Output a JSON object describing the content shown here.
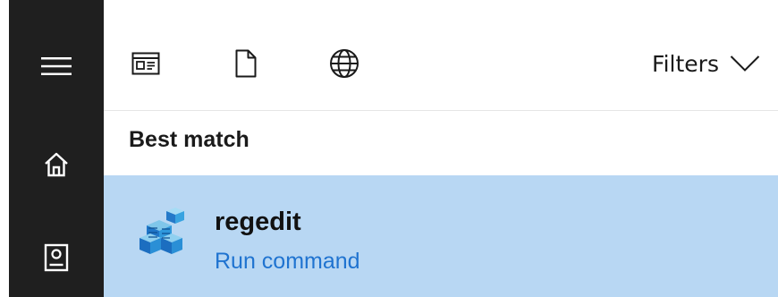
{
  "sidebar": {
    "items": [
      {
        "icon": "hamburger-menu-icon"
      },
      {
        "icon": "home-icon"
      },
      {
        "icon": "notebook-icon"
      }
    ]
  },
  "topbar": {
    "scopes": [
      {
        "icon": "apps-icon"
      },
      {
        "icon": "documents-icon"
      },
      {
        "icon": "web-icon"
      }
    ],
    "filters_label": "Filters"
  },
  "results": {
    "section_title": "Best match",
    "best_match": {
      "title": "regedit",
      "subtitle": "Run command",
      "icon": "registry-editor-icon"
    }
  },
  "colors": {
    "sidebar_bg": "#1f1f1f",
    "selected_bg": "#b8d7f3",
    "accent_blue": "#1f73d0"
  }
}
